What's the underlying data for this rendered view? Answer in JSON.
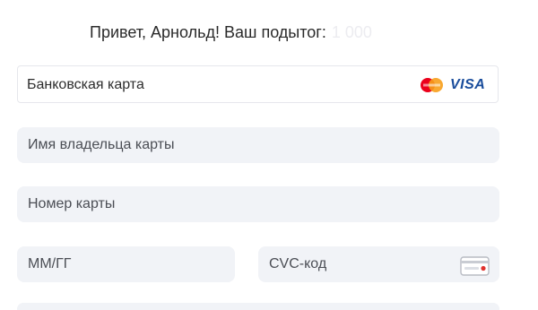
{
  "header": {
    "greeting": "Привет, Арнольд! Ваш подытог:",
    "amount": "1 000"
  },
  "payment_method": {
    "label": "Банковская карта",
    "visa_text": "VISA",
    "mastercard_icon": "mastercard-logo",
    "visa_icon": "visa-logo"
  },
  "form": {
    "cardholder_placeholder": "Имя владельца карты",
    "card_number_placeholder": "Номер карты",
    "expiry_placeholder": "ММ/ГГ",
    "cvc_placeholder": "CVC-код",
    "cvc_icon": "card-cvc-icon"
  },
  "colors": {
    "field_bg": "#f1f3f7",
    "visa_blue": "#1a4d9c",
    "mastercard_red": "#eb001b",
    "mastercard_orange": "#f79e1b"
  }
}
